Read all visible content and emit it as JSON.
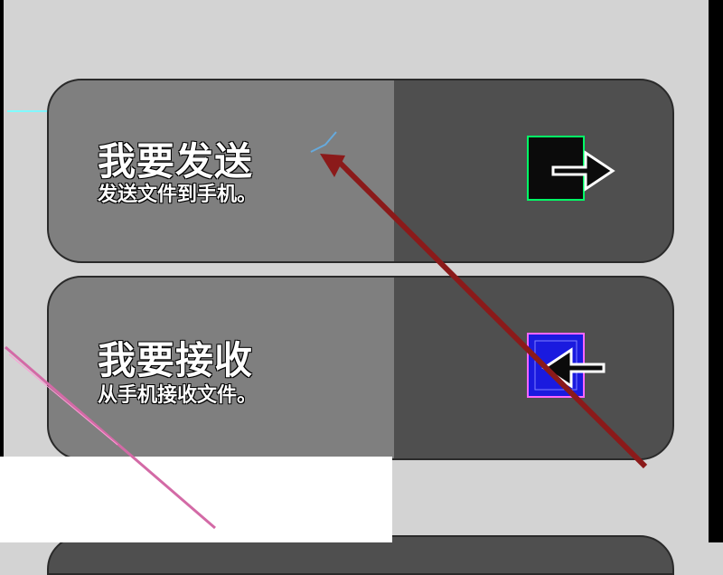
{
  "colors": {
    "background": "#d3d3d3",
    "card_bg": "#4f4f4f",
    "card_left_pane": "#7f7f7f",
    "annotation_arrow": "#8b1a1a",
    "receive_icon_blue": "#1a1adf"
  },
  "cards": [
    {
      "title": "我要发送",
      "subtitle": "发送文件到手机。",
      "icon": "send-file-icon"
    },
    {
      "title": "我要接收",
      "subtitle": "从手机接收文件。",
      "icon": "receive-file-icon"
    }
  ]
}
